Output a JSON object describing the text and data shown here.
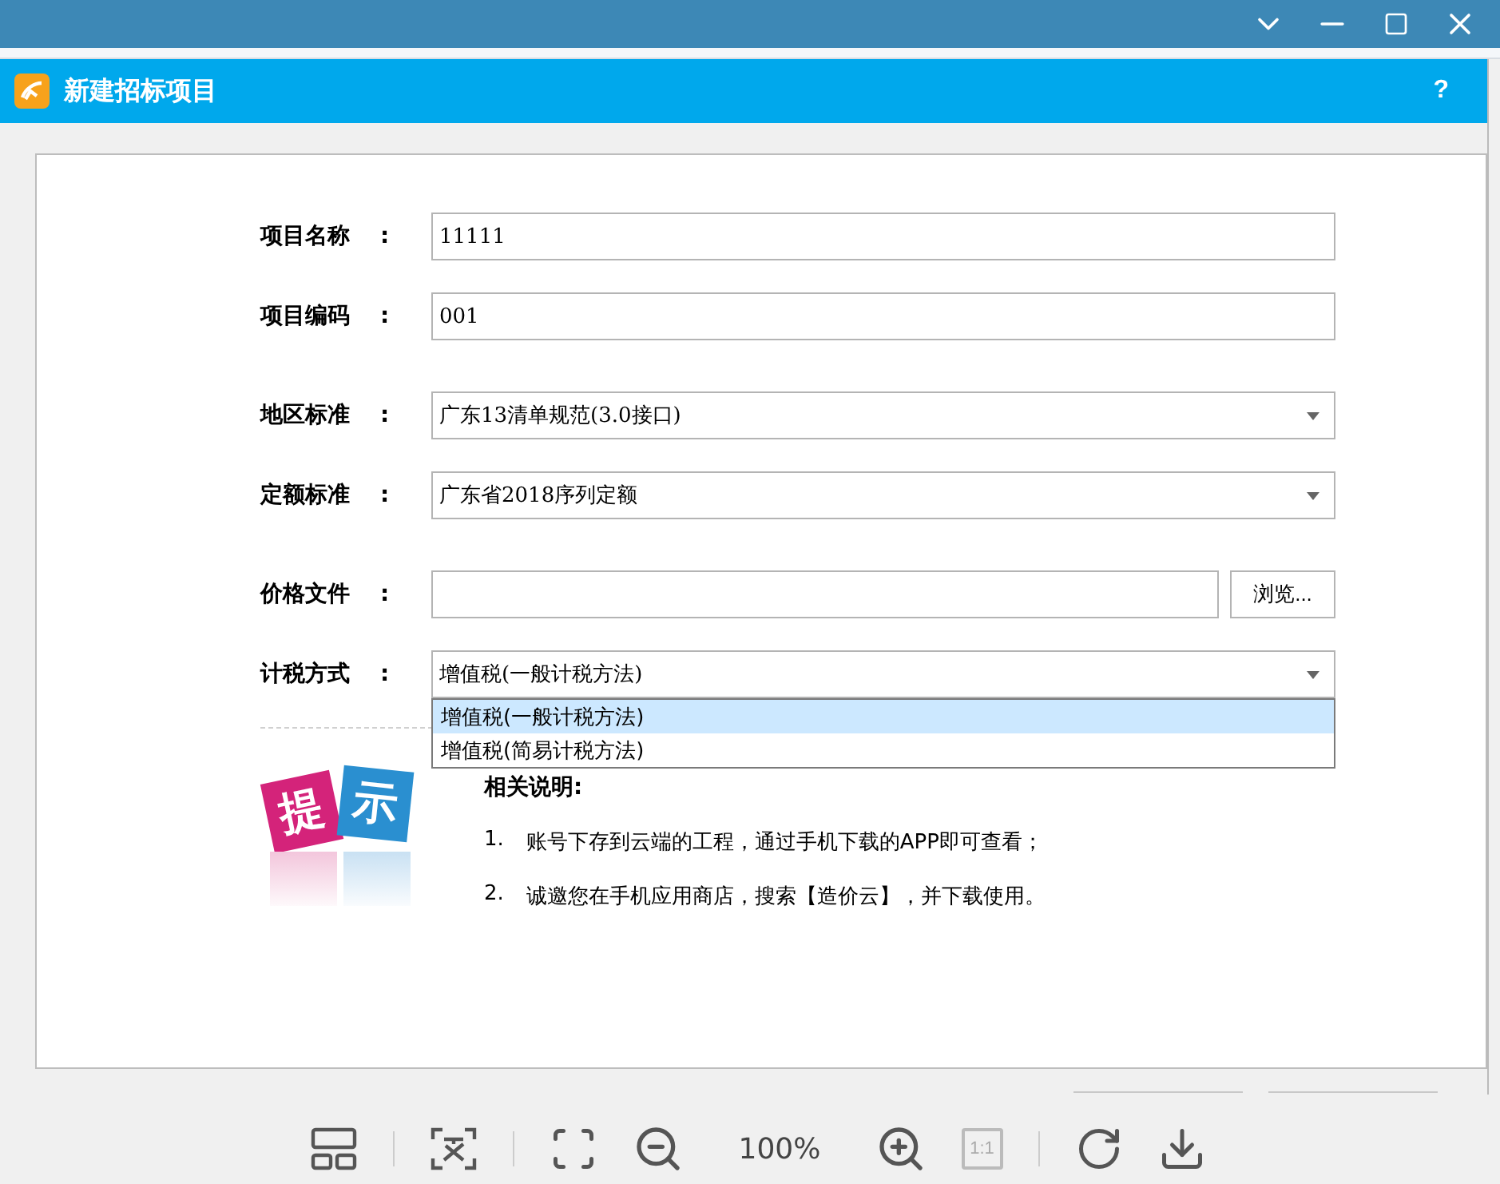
{
  "dialog": {
    "title": "新建招标项目",
    "help": "?"
  },
  "sections": [
    {
      "fields": [
        {
          "kind": "text",
          "label": "项目名称",
          "colon": ":",
          "value": "11111"
        },
        {
          "kind": "text",
          "label": "项目编码",
          "colon": ":",
          "value": "001"
        }
      ]
    },
    {
      "fields": [
        {
          "kind": "select",
          "label": "地区标准",
          "colon": ":",
          "value": "广东13清单规范(3.0接口)"
        },
        {
          "kind": "select",
          "label": "定额标准",
          "colon": ":",
          "value": "广东省2018序列定额"
        }
      ]
    },
    {
      "fields": [
        {
          "kind": "file",
          "label": "价格文件",
          "colon": ":",
          "button": "浏览..."
        },
        {
          "kind": "select",
          "label": "计税方式",
          "colon": ":",
          "value": "增值税(一般计税方法)",
          "expanded": true,
          "options": [
            {
              "label": "增值税(一般计税方法)",
              "selected": true
            },
            {
              "label": "增值税(简易计税方法)",
              "selected": false
            }
          ]
        }
      ]
    }
  ],
  "tip": {
    "badge": [
      "提",
      "示"
    ],
    "title": "相关说明:",
    "items": [
      {
        "number": "1.",
        "text": "账号下存到云端的工程，通过手机下载的APP即可查看；"
      },
      {
        "number": "2.",
        "text": "诚邀您在手机应用商店，搜索【造价云】，并下载使用。"
      }
    ]
  },
  "viewer_toolbar": {
    "zoom": "100%",
    "actual": {
      "text": "1:1",
      "disabled": true
    }
  }
}
